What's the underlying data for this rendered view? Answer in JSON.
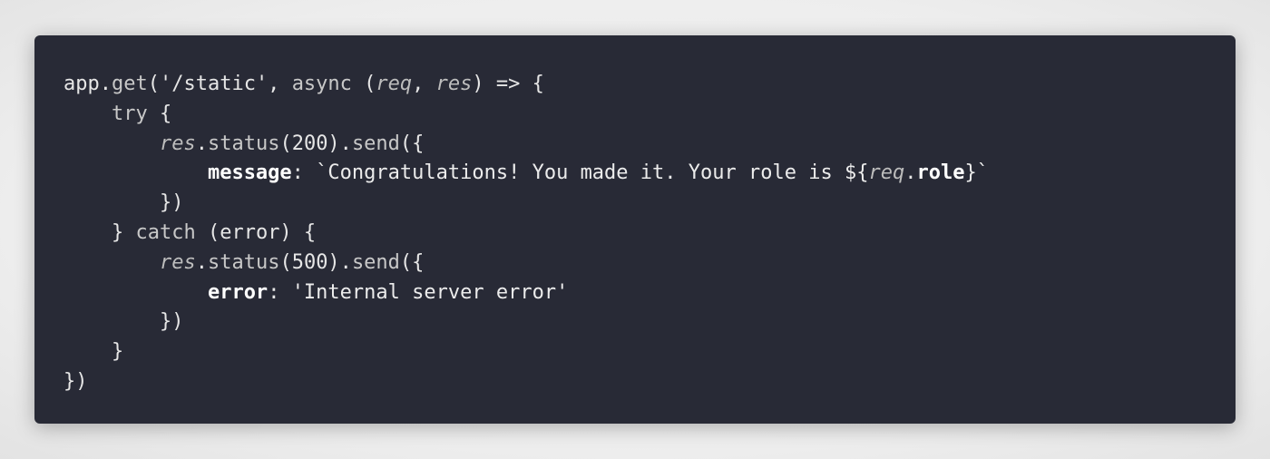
{
  "colors": {
    "page_background": "#ececec",
    "editor_background": "#282a36",
    "default": "#e6e6e6",
    "method": "#c8c8c8",
    "keyword": "#c8c8c8",
    "parameter": "#bdbdbd",
    "string": "#ececec",
    "property": "#ffffff",
    "punctuation": "#e6e6e6"
  },
  "code": {
    "language": "javascript",
    "lines": [
      {
        "indent": 0,
        "tokens": [
          {
            "text": "app.",
            "kind": "default"
          },
          {
            "text": "get",
            "kind": "method"
          },
          {
            "text": "('/static', ",
            "kind": "default"
          },
          {
            "text": "async",
            "kind": "keyword"
          },
          {
            "text": " (",
            "kind": "default"
          },
          {
            "text": "req",
            "kind": "parameter"
          },
          {
            "text": ", ",
            "kind": "default"
          },
          {
            "text": "res",
            "kind": "parameter"
          },
          {
            "text": ") => {",
            "kind": "default"
          }
        ]
      },
      {
        "indent": 1,
        "tokens": [
          {
            "text": "try",
            "kind": "keyword"
          },
          {
            "text": " {",
            "kind": "default"
          }
        ]
      },
      {
        "indent": 2,
        "tokens": [
          {
            "text": "res",
            "kind": "parameter"
          },
          {
            "text": ".",
            "kind": "default"
          },
          {
            "text": "status",
            "kind": "method"
          },
          {
            "text": "(200).",
            "kind": "default"
          },
          {
            "text": "send",
            "kind": "method"
          },
          {
            "text": "({",
            "kind": "default"
          }
        ]
      },
      {
        "indent": 3,
        "tokens": [
          {
            "text": "message",
            "kind": "property"
          },
          {
            "text": ": ",
            "kind": "default"
          },
          {
            "text": "`Congratulations! You made it. Your role is ${",
            "kind": "string"
          },
          {
            "text": "req",
            "kind": "parameter"
          },
          {
            "text": ".",
            "kind": "default"
          },
          {
            "text": "role",
            "kind": "property"
          },
          {
            "text": "}`",
            "kind": "string"
          }
        ]
      },
      {
        "indent": 2,
        "tokens": [
          {
            "text": "})",
            "kind": "default"
          }
        ]
      },
      {
        "indent": 1,
        "tokens": [
          {
            "text": "} ",
            "kind": "default"
          },
          {
            "text": "catch",
            "kind": "keyword"
          },
          {
            "text": " (error) {",
            "kind": "default"
          }
        ]
      },
      {
        "indent": 2,
        "tokens": [
          {
            "text": "res",
            "kind": "parameter"
          },
          {
            "text": ".",
            "kind": "default"
          },
          {
            "text": "status",
            "kind": "method"
          },
          {
            "text": "(500).",
            "kind": "default"
          },
          {
            "text": "send",
            "kind": "method"
          },
          {
            "text": "({",
            "kind": "default"
          }
        ]
      },
      {
        "indent": 3,
        "tokens": [
          {
            "text": "error",
            "kind": "property"
          },
          {
            "text": ": ",
            "kind": "default"
          },
          {
            "text": "'Internal server error'",
            "kind": "string"
          }
        ]
      },
      {
        "indent": 2,
        "tokens": [
          {
            "text": "})",
            "kind": "default"
          }
        ]
      },
      {
        "indent": 1,
        "tokens": [
          {
            "text": "}",
            "kind": "default"
          }
        ]
      },
      {
        "indent": 0,
        "tokens": [
          {
            "text": "})",
            "kind": "default"
          }
        ]
      }
    ]
  }
}
